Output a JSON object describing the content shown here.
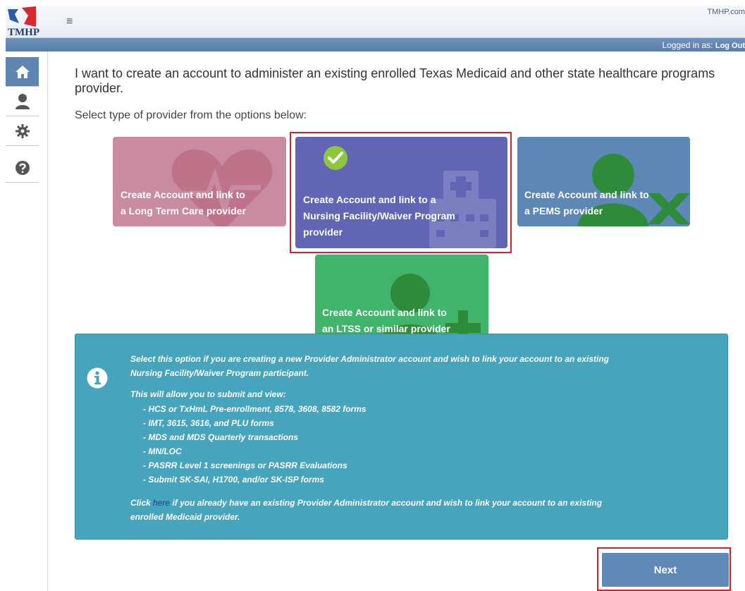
{
  "header": {
    "logo_text": "TMHP",
    "top_link": "TMHP.com",
    "logged_in_label": "Logged in as:",
    "logout_label": "Log Out"
  },
  "sidebar": {
    "items": [
      {
        "name": "home",
        "icon": "home-icon",
        "active": true
      },
      {
        "name": "user",
        "icon": "user-icon",
        "active": false
      },
      {
        "name": "settings",
        "icon": "gear-icon",
        "active": false
      },
      {
        "name": "help",
        "icon": "help-icon",
        "active": false
      }
    ]
  },
  "main": {
    "intro": "I want to create an account to administer an existing enrolled Texas Medicaid and other state healthcare programs provider.",
    "subintro": "Select type of provider from the options below:",
    "tiles": [
      {
        "line1": "Create Account and link to",
        "line2": "a Long Term Care provider",
        "line3": "",
        "color": "#c98ba0",
        "selected": false
      },
      {
        "line1": "Create Account and link to a",
        "line2": "Nursing Facility/Waiver Program",
        "line3": "provider",
        "color": "#6165b3",
        "selected": true
      },
      {
        "line1": "Create Account and link to",
        "line2": "a PEMS provider",
        "line3": "",
        "color": "#5d87b4",
        "selected": false
      },
      {
        "line1": "Create Account and link to",
        "line2": "an LTSS or similar provider",
        "line3": "",
        "color": "#3fb46a",
        "selected": false
      }
    ]
  },
  "info": {
    "p1_line1": "Select this option if you are creating a new Provider Administrator account and wish to link your account to an existing",
    "p1_line2": "Nursing Facility/Waiver Program participant.",
    "p2": "This will allow you to submit and view:",
    "list": [
      "- HCS or TxHmL Pre-enrollment, 8578, 3608, 8582 forms",
      "- IMT, 3615, 3616, and PLU forms",
      "- MDS and MDS Quarterly transactions",
      "- MN/LOC",
      "- PASRR Level 1 screenings or PASRR Evaluations",
      "- Submit SK-SAI, H1700, and/or SK-ISP forms"
    ],
    "click_prefix": "Click",
    "click_link": "here",
    "click_suffix_line1": "if you already have an existing Provider Administrator account and wish to link your account to an existing",
    "click_suffix_line2": "enrolled Medicaid provider."
  },
  "actions": {
    "next_label": "Next"
  },
  "colors": {
    "accent_blue": "#5f88b6",
    "selection_red": "#c8252e",
    "info_teal": "#46a4bd"
  }
}
